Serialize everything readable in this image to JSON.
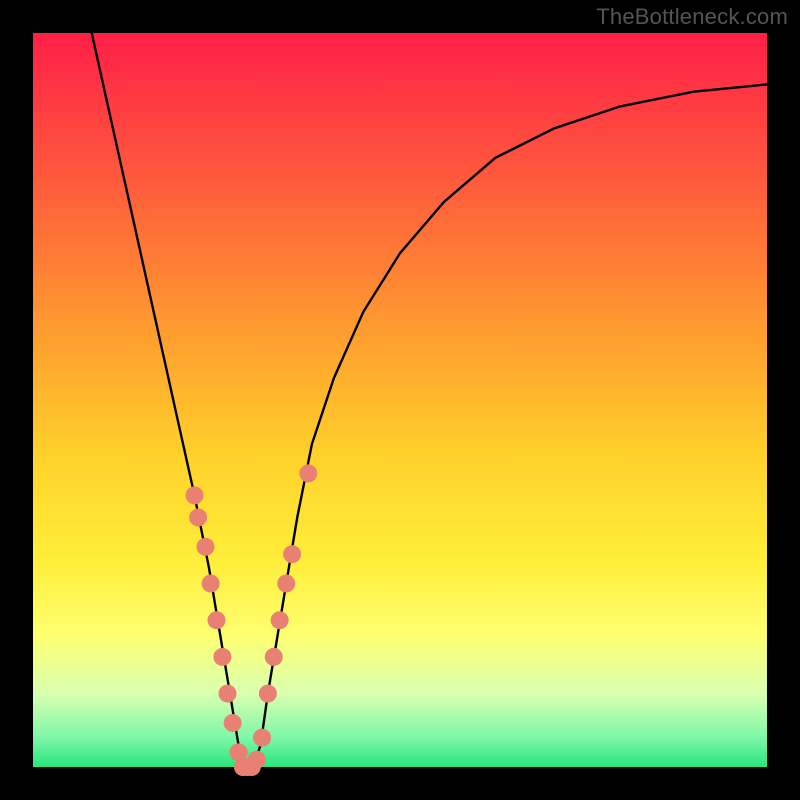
{
  "watermark": "TheBottleneck.com",
  "plot": {
    "inner_x": 33,
    "inner_y": 33,
    "inner_w": 734,
    "inner_h": 734
  },
  "gradient": {
    "stops": [
      {
        "offset": 0.0,
        "color": "#ff1f47"
      },
      {
        "offset": 0.2,
        "color": "#ff5a3c"
      },
      {
        "offset": 0.4,
        "color": "#ff9a2f"
      },
      {
        "offset": 0.58,
        "color": "#ffd22a"
      },
      {
        "offset": 0.72,
        "color": "#ffee3a"
      },
      {
        "offset": 0.82,
        "color": "#feff70"
      },
      {
        "offset": 0.9,
        "color": "#d9ffb0"
      },
      {
        "offset": 0.96,
        "color": "#7ef7a8"
      },
      {
        "offset": 1.0,
        "color": "#26e67c"
      }
    ]
  },
  "chart_data": {
    "type": "line",
    "title": "",
    "xlabel": "",
    "ylabel": "",
    "xlim": [
      0,
      100
    ],
    "ylim": [
      0,
      100
    ],
    "x": [
      8,
      10,
      12,
      14,
      16,
      18,
      20,
      22,
      24,
      25.5,
      27,
      28,
      29,
      30,
      31,
      32,
      34,
      36,
      38,
      41,
      45,
      50,
      56,
      63,
      71,
      80,
      90,
      100
    ],
    "values": [
      100,
      91,
      82,
      73,
      64,
      55,
      46,
      37,
      27,
      18,
      9,
      3,
      0,
      0,
      3,
      10,
      22,
      34,
      44,
      53,
      62,
      70,
      77,
      83,
      87,
      90,
      92,
      93
    ],
    "series_name": "bottleneck-curve",
    "markers": {
      "color": "#e88074",
      "points": [
        {
          "x": 22.0,
          "y": 37
        },
        {
          "x": 22.5,
          "y": 34
        },
        {
          "x": 23.5,
          "y": 30
        },
        {
          "x": 24.2,
          "y": 25
        },
        {
          "x": 25.0,
          "y": 20
        },
        {
          "x": 25.8,
          "y": 15
        },
        {
          "x": 26.5,
          "y": 10
        },
        {
          "x": 27.2,
          "y": 6
        },
        {
          "x": 28.0,
          "y": 2
        },
        {
          "x": 28.6,
          "y": 0
        },
        {
          "x": 29.2,
          "y": 0
        },
        {
          "x": 29.8,
          "y": 0
        },
        {
          "x": 30.5,
          "y": 1
        },
        {
          "x": 31.2,
          "y": 4
        },
        {
          "x": 32.0,
          "y": 10
        },
        {
          "x": 32.8,
          "y": 15
        },
        {
          "x": 33.6,
          "y": 20
        },
        {
          "x": 34.5,
          "y": 25
        },
        {
          "x": 35.3,
          "y": 29
        },
        {
          "x": 37.5,
          "y": 40
        }
      ]
    }
  }
}
